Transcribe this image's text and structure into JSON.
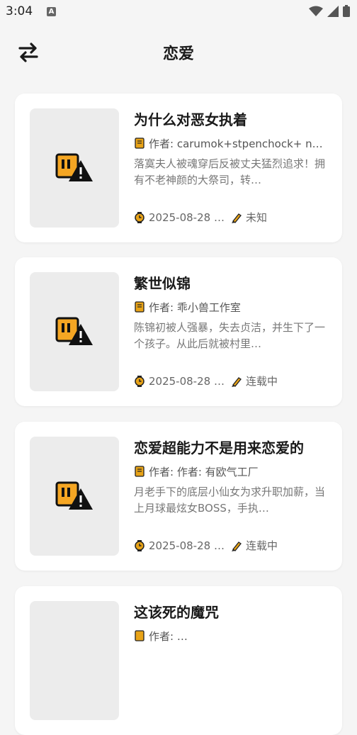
{
  "status": {
    "time": "3:04",
    "a_badge": "A"
  },
  "header": {
    "title": "恋爱"
  },
  "author_prefix": "作者: ",
  "books": [
    {
      "title": "为什么对恶女执着",
      "author": "作者: carumok+stpenchock+ n…",
      "desc": "落寞夫人被魂穿后反被丈夫猛烈追求！拥有不老神颜的大祭司，转…",
      "date": "2025-08-28 1…",
      "status": "未知"
    },
    {
      "title": "繁世似锦",
      "author": "作者: 乖小兽工作室",
      "desc": "陈锦初被人强暴，失去贞洁，并生下了一个孩子。从此后就被村里…",
      "date": "2025-08-28 1…",
      "status": "连载中"
    },
    {
      "title": "恋爱超能力不是用来恋爱的",
      "author": "作者: 作者: 有欧气工厂",
      "desc": "月老手下的底层小仙女为求升职加薪，当上月球最炫女BOSS，手执…",
      "date": "2025-08-28 1…",
      "status": "连载中"
    },
    {
      "title": "这该死的魔咒",
      "author": "作者: …",
      "desc": "",
      "date": "",
      "status": ""
    }
  ]
}
